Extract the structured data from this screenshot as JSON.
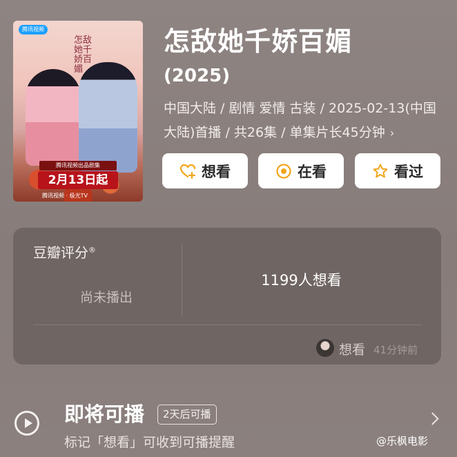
{
  "poster": {
    "platform": "腾讯视频",
    "vertical_title": "怎敌她千娇百媚",
    "ribbon": "腾讯视频出品剧集",
    "date_banner": "2月13日起",
    "logos": "腾讯视频 · 极光TV"
  },
  "header": {
    "title": "怎敌她千娇百媚",
    "year": "(2025)",
    "meta": "中国大陆 / 剧情 爱情 古装 / 2025-02-13(中国大陆)首播 / 共26集 / 单集片长45分钟"
  },
  "actions": {
    "want_label": "想看",
    "watching_label": "在看",
    "watched_label": "看过"
  },
  "rating": {
    "label": "豆瓣评分",
    "trademark": "®",
    "status": "尚未播出",
    "want_count": "1199人想看",
    "activity_action": "想看",
    "activity_time": "41分钟前"
  },
  "upcoming": {
    "title": "即将可播",
    "badge": "2天后可播",
    "hint": "标记「想看」可收到可播提醒"
  },
  "watermark": "@乐枫电影",
  "colors": {
    "background": "#8a7f7d",
    "panel": "#6f6563",
    "accent_orange": "#f2a51a"
  }
}
